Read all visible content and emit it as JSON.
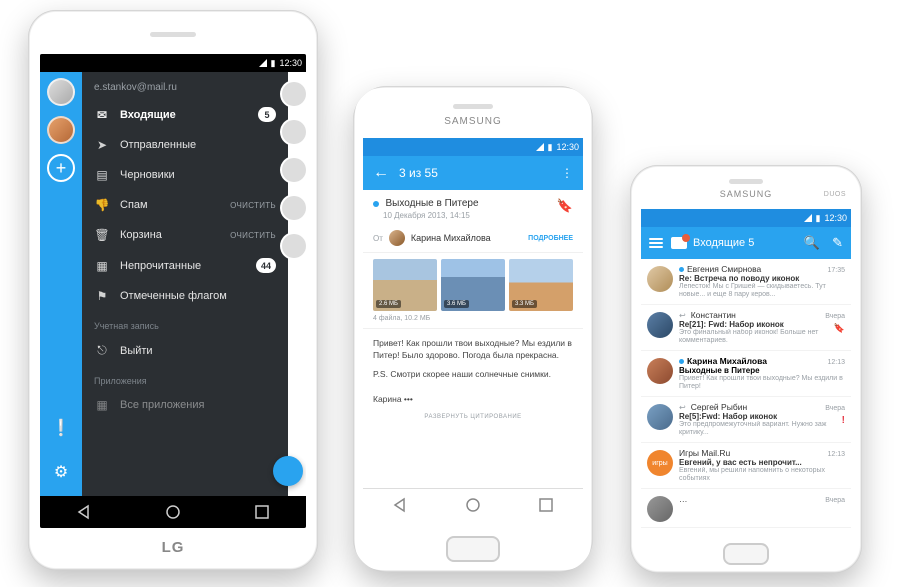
{
  "statusbar": {
    "time": "12:30"
  },
  "phone1": {
    "brand": "LG",
    "email": "e.stankov@mail.ru",
    "folders": [
      {
        "icon": "✉",
        "label": "Входящие",
        "badge": "5",
        "active": true
      },
      {
        "icon": "➤",
        "label": "Отправленные"
      },
      {
        "icon": "▤",
        "label": "Черновики"
      },
      {
        "icon": "👎",
        "label": "Спам",
        "aux": "очистить"
      },
      {
        "icon": "🗑",
        "label": "Корзина",
        "aux": "очистить"
      },
      {
        "icon": "▦",
        "label": "Непрочитанные",
        "badge": "44"
      },
      {
        "icon": "⚑",
        "label": "Отмеченные флагом"
      }
    ],
    "group_account": "Учетная запись",
    "logout": {
      "icon": "⎋",
      "label": "Выйти"
    },
    "group_apps": "Приложения",
    "all_apps": {
      "icon": "▦",
      "label": "Все приложения"
    }
  },
  "phone2": {
    "brand": "SAMSUNG",
    "appbar_title": "3 из 55",
    "subject": "Выходные в Питере",
    "date": "10 Декабря 2013, 14:15",
    "from_label": "От",
    "from_name": "Карина Михайлова",
    "details": "ПОДРОБНЕЕ",
    "att_sizes": [
      "2.6 МБ",
      "3.6 МБ",
      "3.3 МБ"
    ],
    "att_info": "4 файла, 10.2 МБ",
    "body_p1": "Привет! Как прошли твои выходные? Мы ездили в Питер! Было здорово. Погода была прекрасна.",
    "body_p2": "P.S. Смотри скорее наши солнечные снимки.",
    "signature": "Карина •••",
    "expand": "РАЗВЕРНУТЬ ЦИТИРОВАНИЕ"
  },
  "phone3": {
    "brand": "SAMSUNG",
    "duos": "DUOS",
    "appbar_title": "Входящие 5",
    "messages": [
      {
        "unread": true,
        "from": "Евгения Смирнова",
        "subj": "Re: Встреча по поводу иконок",
        "prev": "Лепесток! Мы с Гришей — скидываетесь. Тут новые... и еще 8 пару керов...",
        "time": "17:35",
        "av": "c1"
      },
      {
        "unread": false,
        "reply": true,
        "from": "Константин",
        "subj": "Re[21]: Fwd: Набор иконок",
        "prev": "Это финальный набор иконок! Больше нет комментариев.",
        "time": "Вчера",
        "av": "c2",
        "bookmarked": true
      },
      {
        "unread": true,
        "from": "Карина Михайлова",
        "subj": "Выходные в Питере",
        "prev": "Привет! Как прошли твои выходные? Мы ездили в Питер!",
        "time": "12:13",
        "av": "c3",
        "bold": true
      },
      {
        "unread": false,
        "reply": true,
        "from": "Сергей Рыбин",
        "subj": "Re[5]:Fwd:  Набор иконок",
        "prev": "Это предпромежуточный вариант. Нужно заж критику...",
        "time": "Вчера",
        "av": "c4",
        "important": true
      },
      {
        "unread": false,
        "from": "Игры Mail.Ru",
        "subj": "Евгений, у вас есть непрочит...",
        "prev": "Евгений, мы решили напомнить о некоторых событиях",
        "time": "12:13",
        "av": "c5"
      },
      {
        "unread": false,
        "from": "…",
        "subj": "",
        "prev": "",
        "time": "Вчера",
        "av": "c6"
      }
    ]
  }
}
